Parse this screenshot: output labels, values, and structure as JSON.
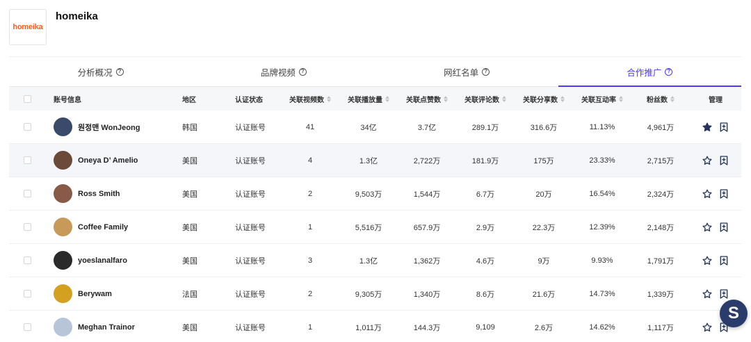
{
  "brand": {
    "logo_text": "homeika",
    "name": "homeika",
    "logo_color": "#ff5a1f"
  },
  "tabs": [
    {
      "label": "分析概况",
      "help": "?"
    },
    {
      "label": "品牌视频",
      "help": "?"
    },
    {
      "label": "网红名单",
      "help": "?"
    },
    {
      "label": "合作推广",
      "help": "?",
      "active": true
    }
  ],
  "accent_color": "#4a3aff",
  "table": {
    "headers": {
      "account": "账号信息",
      "region": "地区",
      "verify": "认证状态",
      "videos": "关联视频数",
      "plays": "关联播放量",
      "likes": "关联点赞数",
      "comments": "关联评论数",
      "shares": "关联分享数",
      "engagement": "关联互动率",
      "followers": "粉丝数",
      "manage": "管理"
    },
    "rows": [
      {
        "name": "원정맨 WonJeong",
        "region": "韩国",
        "verify": "认证账号",
        "videos": "41",
        "plays": "34亿",
        "likes": "3.7亿",
        "comments": "289.1万",
        "shares": "316.6万",
        "engagement": "11.13%",
        "followers": "4,961万",
        "starred": true,
        "avatar_color": "#3a4a6a"
      },
      {
        "name": "Oneya D’ Amelio",
        "region": "美国",
        "verify": "认证账号",
        "videos": "4",
        "plays": "1.3亿",
        "likes": "2,722万",
        "comments": "181.9万",
        "shares": "175万",
        "engagement": "23.33%",
        "followers": "2,715万",
        "starred": false,
        "avatar_color": "#6b4a3a"
      },
      {
        "name": "Ross Smith",
        "region": "美国",
        "verify": "认证账号",
        "videos": "2",
        "plays": "9,503万",
        "likes": "1,544万",
        "comments": "6.7万",
        "shares": "20万",
        "engagement": "16.54%",
        "followers": "2,324万",
        "starred": false,
        "avatar_color": "#8a5a48"
      },
      {
        "name": "Coffee Family",
        "region": "美国",
        "verify": "认证账号",
        "videos": "1",
        "plays": "5,516万",
        "likes": "657.9万",
        "comments": "2.9万",
        "shares": "22.3万",
        "engagement": "12.39%",
        "followers": "2,148万",
        "starred": false,
        "avatar_color": "#c89a5a"
      },
      {
        "name": "yoeslanalfaro",
        "region": "美国",
        "verify": "认证账号",
        "videos": "3",
        "plays": "1.3亿",
        "likes": "1,362万",
        "comments": "4.6万",
        "shares": "9万",
        "engagement": "9.93%",
        "followers": "1,791万",
        "starred": false,
        "avatar_color": "#2a2a2a"
      },
      {
        "name": "Berywam",
        "region": "法国",
        "verify": "认证账号",
        "videos": "2",
        "plays": "9,305万",
        "likes": "1,340万",
        "comments": "8.6万",
        "shares": "21.6万",
        "engagement": "14.73%",
        "followers": "1,339万",
        "starred": false,
        "avatar_color": "#d4a020"
      },
      {
        "name": "Meghan Trainor",
        "region": "美国",
        "verify": "认证账号",
        "videos": "1",
        "plays": "1,011万",
        "likes": "144.3万",
        "comments": "9,109",
        "shares": "2.6万",
        "engagement": "14.62%",
        "followers": "1,117万",
        "starred": false,
        "avatar_color": "#b8c4d8"
      }
    ]
  },
  "fab": {
    "label": "S",
    "color": "#2a3c6b"
  }
}
